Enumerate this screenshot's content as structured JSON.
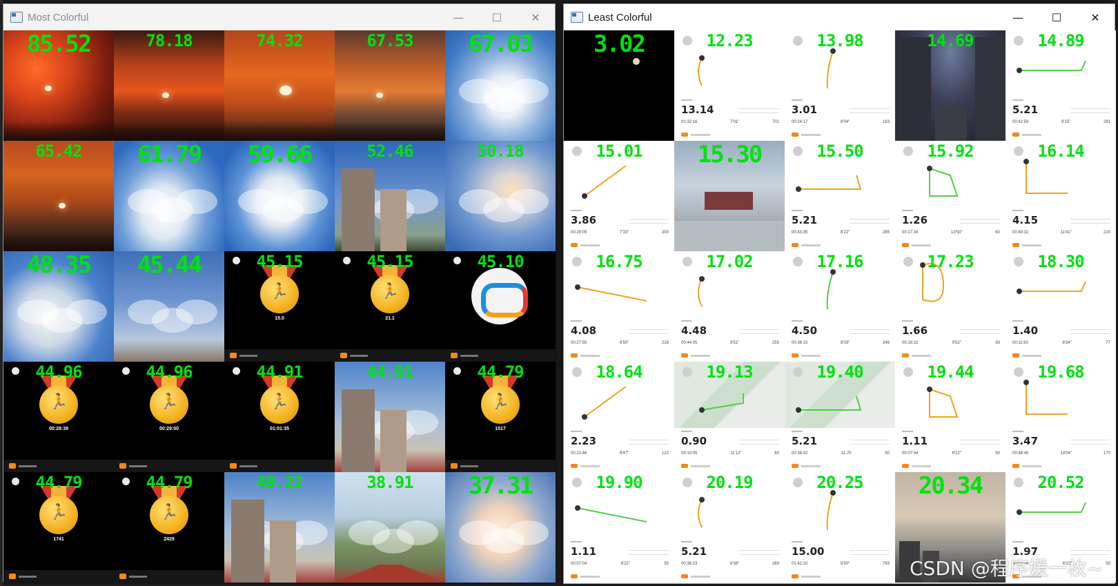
{
  "windows": {
    "most": {
      "title": "Most Colorful",
      "tiles": [
        {
          "score": "85.52",
          "kind": "sunset1",
          "big": true
        },
        {
          "score": "78.18",
          "kind": "sunset2"
        },
        {
          "score": "74.32",
          "kind": "sunset3"
        },
        {
          "score": "67.53",
          "kind": "sunset4"
        },
        {
          "score": "67.03",
          "kind": "sky1",
          "big": true
        },
        {
          "score": "65.42",
          "kind": "sunset5"
        },
        {
          "score": "61.79",
          "kind": "sky2",
          "big": true
        },
        {
          "score": "59.66",
          "kind": "sky3",
          "big": true
        },
        {
          "score": "52.46",
          "kind": "tower1"
        },
        {
          "score": "50.18",
          "kind": "sky5"
        },
        {
          "score": "48.35",
          "kind": "sky6",
          "big": true
        },
        {
          "score": "45.44",
          "kind": "sky7",
          "big": true
        },
        {
          "score": "45.15",
          "kind": "medal",
          "medal_text": "15.0"
        },
        {
          "score": "45.15",
          "kind": "medal",
          "medal_text": "21.1"
        },
        {
          "score": "45.10",
          "kind": "logo"
        },
        {
          "score": "44.96",
          "kind": "medal",
          "medal_text": "00:28:39"
        },
        {
          "score": "44.96",
          "kind": "medal",
          "medal_text": "00:29:00"
        },
        {
          "score": "44.91",
          "kind": "medal",
          "medal_text": "01:01:35"
        },
        {
          "score": "44.91",
          "kind": "tower2"
        },
        {
          "score": "44.79",
          "kind": "medal",
          "medal_text": "1517"
        },
        {
          "score": "44.79",
          "kind": "medal",
          "medal_text": "1741"
        },
        {
          "score": "44.79",
          "kind": "medal",
          "medal_text": "2429"
        },
        {
          "score": "40.22",
          "kind": "tower2"
        },
        {
          "score": "38.91",
          "kind": "park"
        },
        {
          "score": "37.31",
          "kind": "sky8",
          "big": true
        }
      ]
    },
    "least": {
      "title": "Least Colorful",
      "tiles": [
        {
          "score": "3.02",
          "kind": "night",
          "big": true
        },
        {
          "score": "12.23",
          "kind": "run",
          "distance": "13.14",
          "time": "01:32:16",
          "pace": "7'01\"",
          "cal": "702"
        },
        {
          "score": "13.98",
          "kind": "run",
          "distance": "3.01",
          "time": "00:24:17",
          "pace": "8'04\"",
          "cal": "163"
        },
        {
          "score": "14.69",
          "kind": "dusk1"
        },
        {
          "score": "14.89",
          "kind": "run",
          "distance": "5.21",
          "time": "00:42:59",
          "pace": "8'15\"",
          "cal": "281"
        },
        {
          "score": "15.01",
          "kind": "run",
          "distance": "3.86",
          "time": "00:29:09",
          "pace": "7'33\"",
          "cal": "200"
        },
        {
          "score": "15.30",
          "kind": "overcast",
          "big": true
        },
        {
          "score": "15.50",
          "kind": "run",
          "distance": "5.21",
          "time": "00:43:35",
          "pace": "8'22\"",
          "cal": "285"
        },
        {
          "score": "15.92",
          "kind": "run",
          "distance": "1.26",
          "time": "00:17:34",
          "pace": "13'50\"",
          "cal": "60"
        },
        {
          "score": "16.14",
          "kind": "run",
          "distance": "4.15",
          "time": "00:40:32",
          "pace": "11'41\"",
          "cal": "220"
        },
        {
          "score": "16.75",
          "kind": "run",
          "distance": "4.08",
          "time": "00:27:55",
          "pace": "6'50\"",
          "cal": "218"
        },
        {
          "score": "17.02",
          "kind": "run",
          "distance": "4.48",
          "time": "00:44:05",
          "pace": "9'51\"",
          "cal": "255"
        },
        {
          "score": "17.16",
          "kind": "run",
          "distance": "4.50",
          "time": "00:36:15",
          "pace": "8'03\"",
          "cal": "246"
        },
        {
          "score": "17.23",
          "kind": "run",
          "distance": "1.66",
          "time": "00:16:22",
          "pace": "9'52\"",
          "cal": "83"
        },
        {
          "score": "18.30",
          "kind": "run",
          "distance": "1.40",
          "time": "00:11:50",
          "pace": "8'34\"",
          "cal": "77"
        },
        {
          "score": "18.64",
          "kind": "run",
          "distance": "2.23",
          "time": "00:21:46",
          "pace": "9'47\"",
          "cal": "122"
        },
        {
          "score": "19.13",
          "kind": "runmap",
          "distance": "0.90",
          "time": "00:10:05",
          "pace": "11'12\"",
          "cal": "60"
        },
        {
          "score": "19.40",
          "kind": "runmap",
          "distance": "5.21",
          "time": "00:36:32",
          "pace": "11.70",
          "cal": "50"
        },
        {
          "score": "19.44",
          "kind": "run",
          "distance": "1.11",
          "time": "00:07:04",
          "pace": "6'22\"",
          "cal": "50"
        },
        {
          "score": "19.68",
          "kind": "run",
          "distance": "3.47",
          "time": "00:48:46",
          "pace": "14'04\"",
          "cal": "170"
        },
        {
          "score": "19.90",
          "kind": "run",
          "distance": "1.11",
          "time": "00:07:04",
          "pace": "6'22\"",
          "cal": "50"
        },
        {
          "score": "20.19",
          "kind": "run",
          "distance": "5.21",
          "time": "00:36:23",
          "pace": "6'58\"",
          "cal": "283"
        },
        {
          "score": "20.25",
          "kind": "run",
          "distance": "15.00",
          "time": "01:42:20",
          "pace": "6'50\"",
          "cal": "793"
        },
        {
          "score": "20.34",
          "kind": "dusk2",
          "big": true
        },
        {
          "score": "20.52",
          "kind": "run",
          "distance": "1.97",
          "time": "00:07:04",
          "pace": "6'22\"",
          "cal": "50"
        }
      ]
    }
  },
  "controls": {
    "minimize": "—",
    "maximize": "☐",
    "close": "✕"
  },
  "watermark": "CSDN @程序媛一枚~",
  "colors": {
    "score": "#00e10f",
    "route": "#f0a020",
    "route_green": "#4fcf3f"
  }
}
